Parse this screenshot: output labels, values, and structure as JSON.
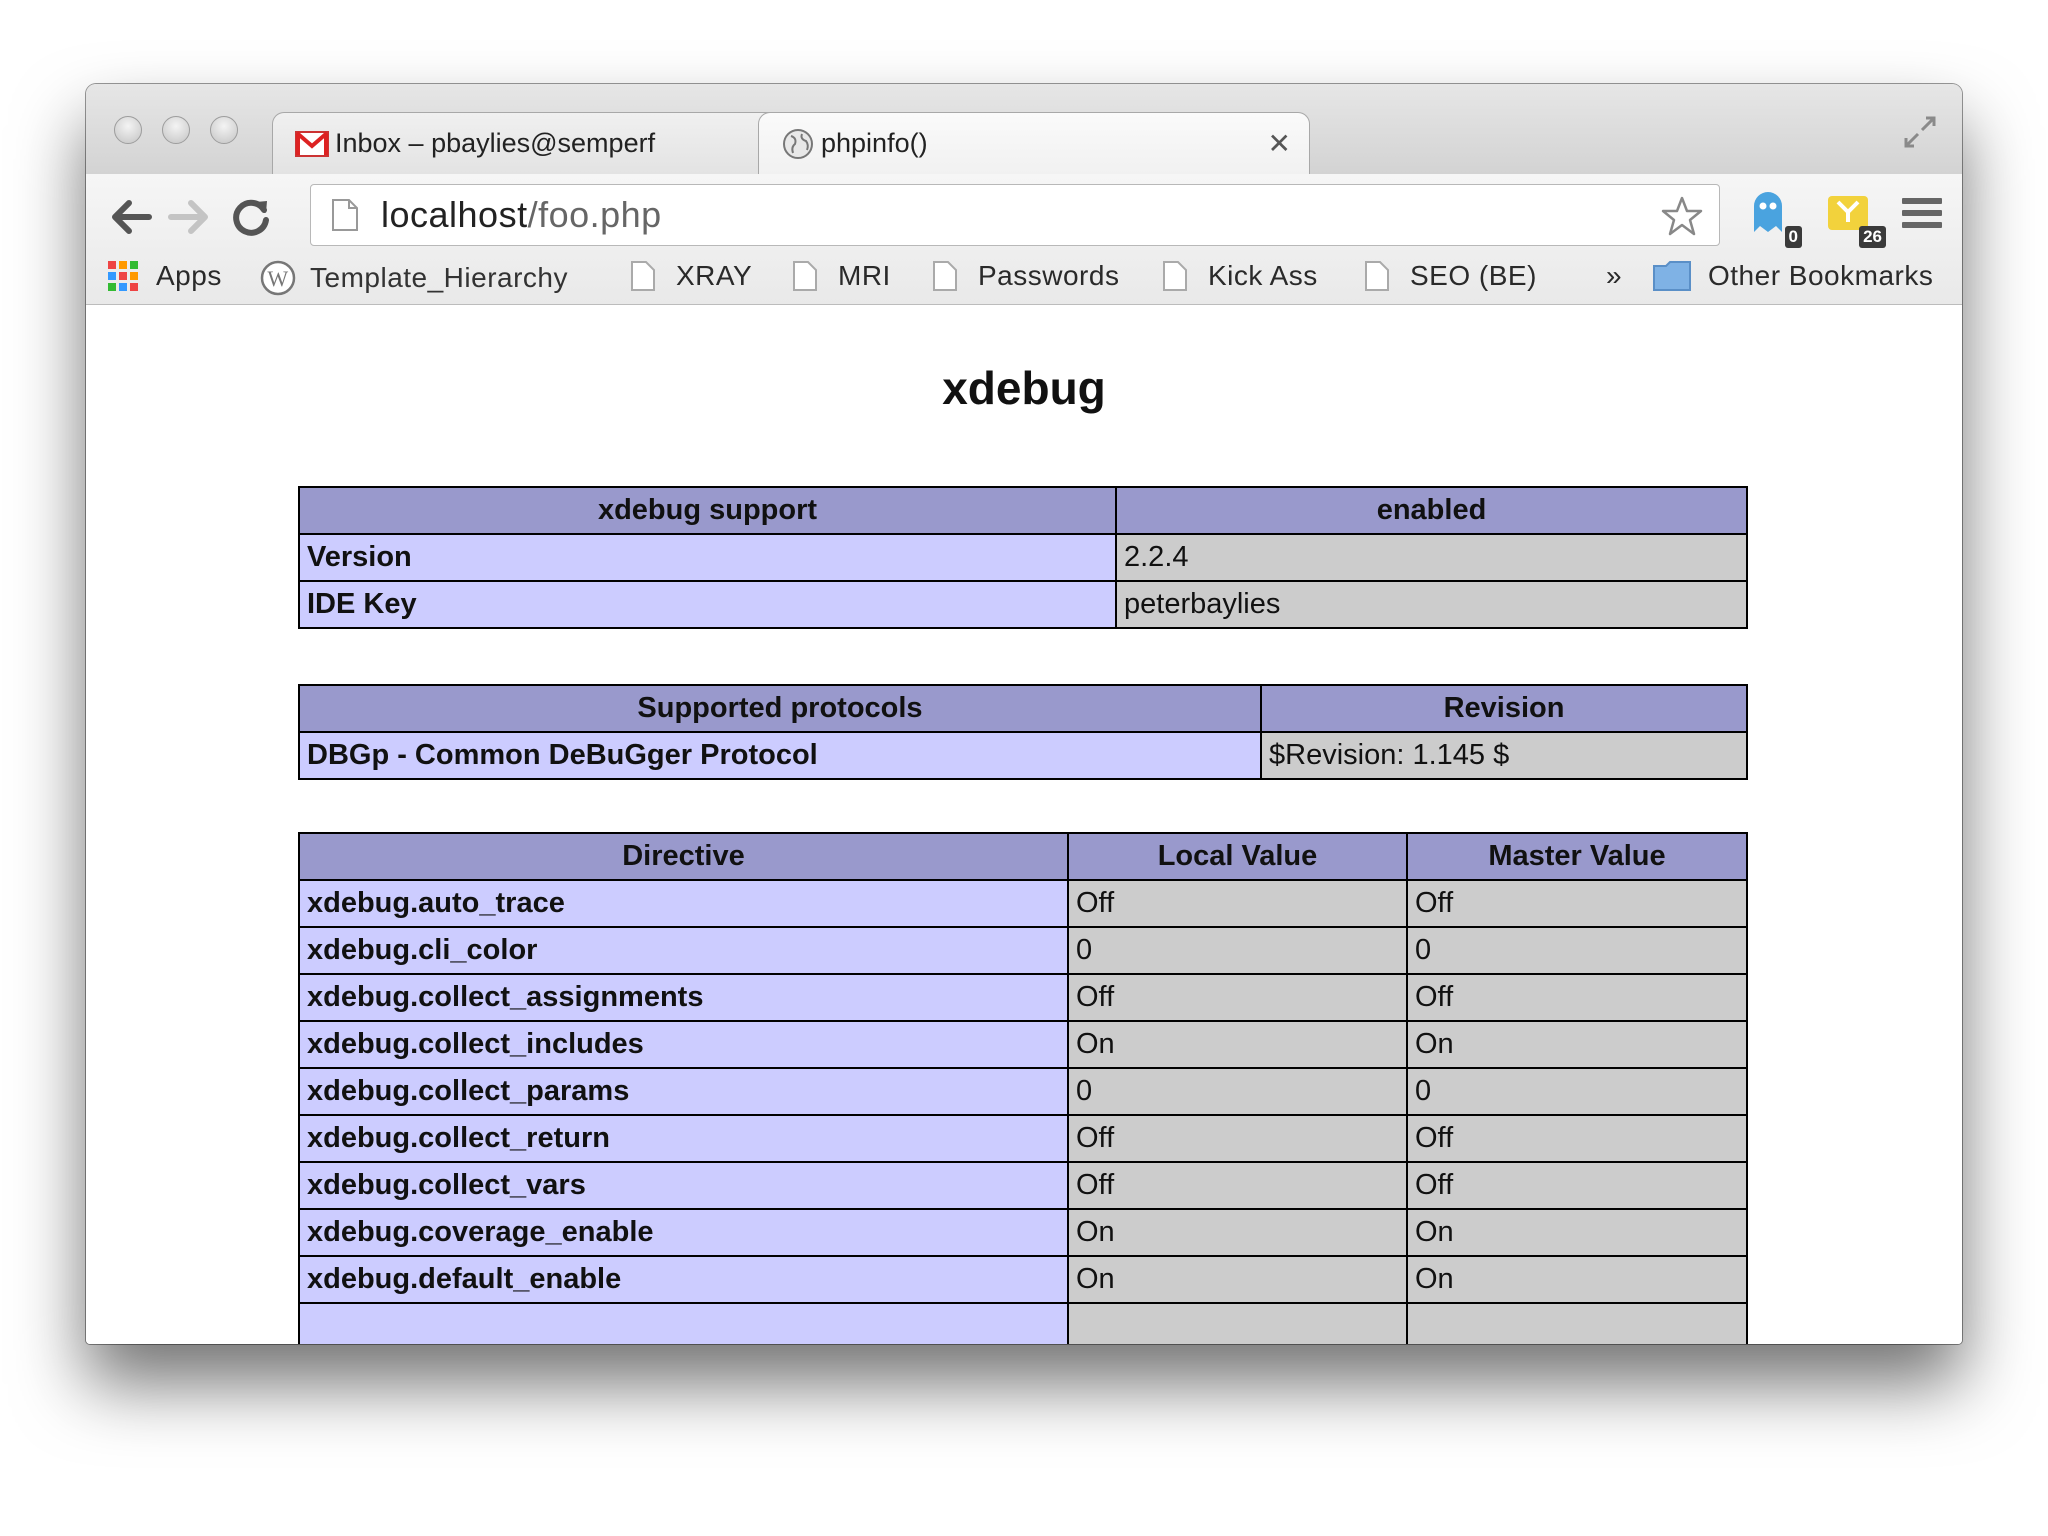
{
  "browser": {
    "tabs": [
      {
        "title": "Inbox – pbaylies@semperf",
        "icon": "gmail-icon"
      },
      {
        "title": "phpinfo()",
        "icon": "globe-icon"
      }
    ],
    "address": {
      "host": "localhost",
      "path": "/foo.php"
    },
    "extensions": [
      {
        "name": "ghostery-icon",
        "badge": "0"
      },
      {
        "name": "extension-icon",
        "badge": "26"
      }
    ],
    "bookmarks": [
      {
        "label": "Apps",
        "icon": "apps-grid-icon"
      },
      {
        "label": "Template_Hierarchy",
        "icon": "wordpress-icon"
      },
      {
        "label": "XRAY",
        "icon": "page-icon"
      },
      {
        "label": "MRI",
        "icon": "page-icon"
      },
      {
        "label": "Passwords",
        "icon": "page-icon"
      },
      {
        "label": "Kick Ass",
        "icon": "page-icon"
      },
      {
        "label": "SEO (BE)",
        "icon": "page-icon"
      }
    ],
    "overflow": "»",
    "other_bookmarks": "Other Bookmarks"
  },
  "page": {
    "title": "xdebug",
    "support_table": {
      "headers": [
        "xdebug support",
        "enabled"
      ],
      "rows": [
        [
          "Version",
          "2.2.4"
        ],
        [
          "IDE Key",
          "peterbaylies"
        ]
      ]
    },
    "protocols_table": {
      "headers": [
        "Supported protocols",
        "Revision"
      ],
      "rows": [
        [
          "DBGp - Common DeBuGger Protocol",
          "$Revision: 1.145 $"
        ]
      ]
    },
    "directives_table": {
      "headers": [
        "Directive",
        "Local Value",
        "Master Value"
      ],
      "rows": [
        [
          "xdebug.auto_trace",
          "Off",
          "Off"
        ],
        [
          "xdebug.cli_color",
          "0",
          "0"
        ],
        [
          "xdebug.collect_assignments",
          "Off",
          "Off"
        ],
        [
          "xdebug.collect_includes",
          "On",
          "On"
        ],
        [
          "xdebug.collect_params",
          "0",
          "0"
        ],
        [
          "xdebug.collect_return",
          "Off",
          "Off"
        ],
        [
          "xdebug.collect_vars",
          "Off",
          "Off"
        ],
        [
          "xdebug.coverage_enable",
          "On",
          "On"
        ],
        [
          "xdebug.default_enable",
          "On",
          "On"
        ],
        [
          "",
          "",
          ""
        ]
      ]
    }
  },
  "colors": {
    "header": "#9999cc",
    "entry": "#ccccff",
    "value": "#cccccc"
  }
}
